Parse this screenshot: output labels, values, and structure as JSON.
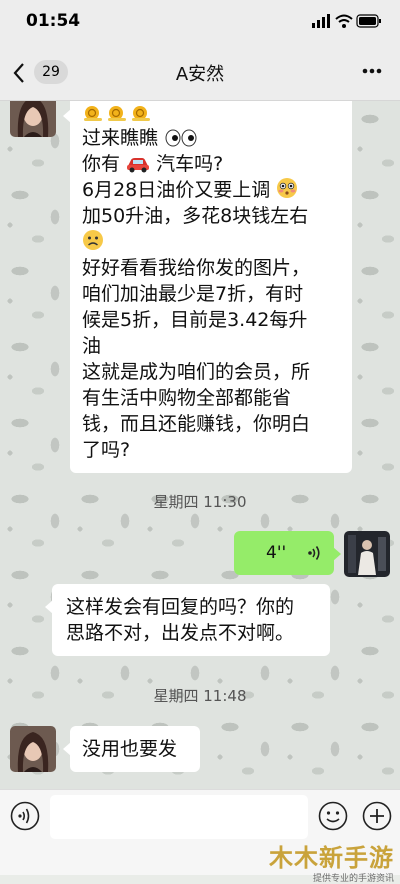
{
  "status_bar": {
    "time": "01:54"
  },
  "nav": {
    "badge_count": "29",
    "title": "A安然"
  },
  "messages": {
    "m1": {
      "lines": [
        "过来瞧瞧",
        "你有",
        "汽车吗?",
        "6月28日油价又要上调",
        "加50升油，多花8块钱左右",
        "好好看看我给你发的图片，",
        "咱们加油最少是7折，有时",
        "候是5折，目前是3.42每升",
        "油",
        "这就是成为咱们的会员，所",
        "有生活中购物全部都能省",
        "钱，而且还能赚钱，你明白",
        "了吗?"
      ]
    },
    "ts1": "星期四 11:30",
    "voice": {
      "duration": "4''"
    },
    "m2": {
      "lines": [
        "这样发会有回复的吗？你的",
        "思路不对，出发点不对啊。"
      ]
    },
    "ts2": "星期四 11:48",
    "m3": {
      "text": "没用也要发"
    }
  },
  "watermark": {
    "main": "木木新手游",
    "sub": "提供专业的手游资讯"
  },
  "colors": {
    "sent_bubble": "#95ec69",
    "received_bubble": "#ffffff",
    "bar_bg": "#ededed"
  }
}
